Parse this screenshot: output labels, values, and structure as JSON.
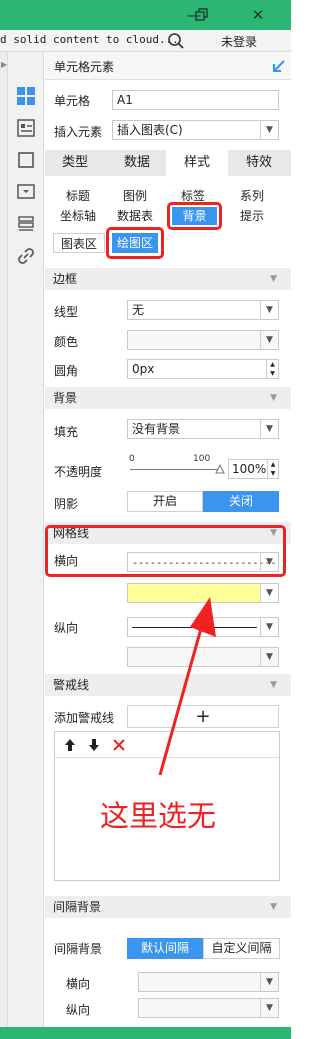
{
  "window": {
    "restore_icon": "window-restore-icon",
    "maximize_glyph": "❐",
    "close_glyph": "✕",
    "minimize_glyph": "—"
  },
  "toolbar": {
    "cloud_text": "d solid content to cloud...",
    "login": "未登录"
  },
  "panel": {
    "title": "单元格元素",
    "cell_label": "单元格",
    "cell_value": "A1",
    "insert_label": "插入元素",
    "insert_value": "插入图表(C)",
    "tabs": [
      "类型",
      "数据",
      "样式",
      "特效"
    ],
    "subtabs_row1": [
      "标题",
      "图例",
      "标签",
      "系列"
    ],
    "subtabs_row2": [
      "坐标轴",
      "数据表",
      "背景",
      "提示"
    ],
    "area_tabs": [
      "图表区",
      "绘图区"
    ]
  },
  "border": {
    "section": "边框",
    "type_label": "线型",
    "type_value": "无",
    "color_label": "颜色",
    "radius_label": "圆角",
    "radius_value": "0px"
  },
  "background": {
    "section": "背景",
    "fill_label": "填充",
    "fill_value": "没有背景",
    "opacity_label": "不透明度",
    "slider_min": "0",
    "slider_max": "100",
    "opacity_value": "100%",
    "shadow_label": "阴影",
    "shadow_on": "开启",
    "shadow_off": "关闭"
  },
  "grid": {
    "section": "网格线",
    "horizontal_label": "横向",
    "horizontal_line": "------------------------",
    "vertical_label": "纵向",
    "highlight_color": "#ffff99"
  },
  "warning": {
    "section": "警戒线",
    "add_label": "添加警戒线",
    "add_symbol": "+"
  },
  "annotation": {
    "text": "这里选无",
    "color": "#ee2222"
  },
  "interval": {
    "section": "间隔背景",
    "label": "间隔背景",
    "default_option": "默认间隔",
    "custom_option": "自定义间隔",
    "h_label": "横向",
    "v_label": "纵向"
  },
  "colors": {
    "accent": "#3a95ee",
    "titlebar": "#2bb673",
    "red": "#ee2222"
  }
}
